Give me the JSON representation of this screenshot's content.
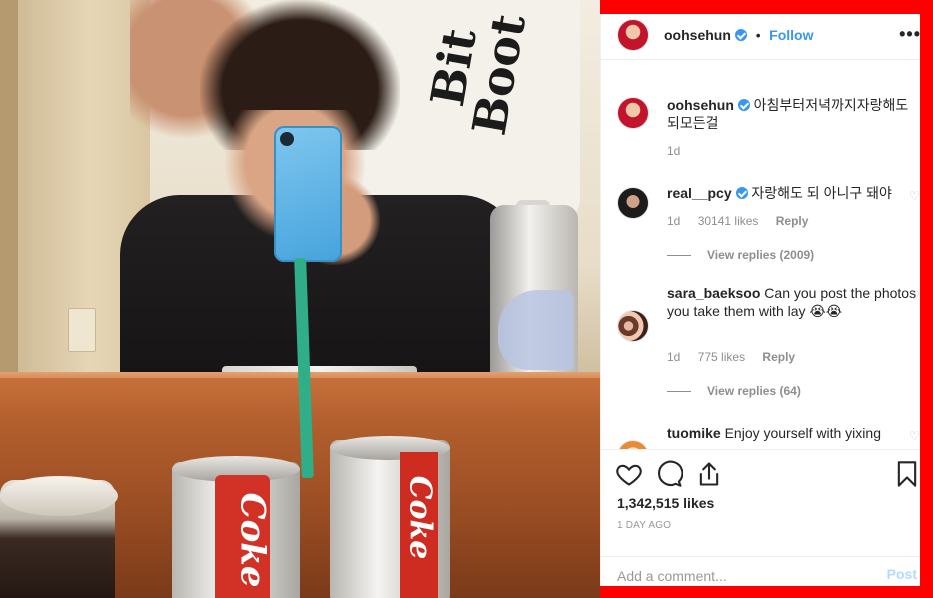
{
  "post": {
    "author": "oohsehun",
    "follow_label": "Follow",
    "separator": "•",
    "more_label": "•••"
  },
  "comments": [
    {
      "user": "oohsehun",
      "verified": true,
      "text": "아침부터저녁까지자랑해도되모든걸",
      "age": "1d"
    },
    {
      "user": "real__pcy",
      "verified": true,
      "text": "자랑해도 되 아니구 돼야",
      "age": "1d",
      "likes": "30141 likes",
      "reply_label": "Reply",
      "view_replies": "View replies (2009)"
    },
    {
      "user": "sara_baeksoo",
      "verified": false,
      "text": "Can you post the photos you take them with lay 😭😭",
      "age": "1d",
      "likes": "775 likes",
      "reply_label": "Reply",
      "view_replies": "View replies (64)"
    },
    {
      "user": "tuomike",
      "verified": false,
      "text": "Enjoy yourself with yixing"
    }
  ],
  "photo_text": {
    "shirt_print": "Bit Boot",
    "can1": "Coke",
    "can2": "Coke"
  },
  "stats": {
    "likes": "1,342,515 likes",
    "posted": "1 DAY AGO"
  },
  "compose": {
    "placeholder": "Add a comment...",
    "post_label": "Post"
  },
  "icons": [
    "heart-icon",
    "comment-icon",
    "share-icon",
    "bookmark-icon",
    "verified-icon",
    "more-icon"
  ],
  "colors": {
    "frame": "#ff0000",
    "link_blue": "#3897f0",
    "post_disabled": "#b3dbff",
    "muted": "#8e8e8e"
  }
}
